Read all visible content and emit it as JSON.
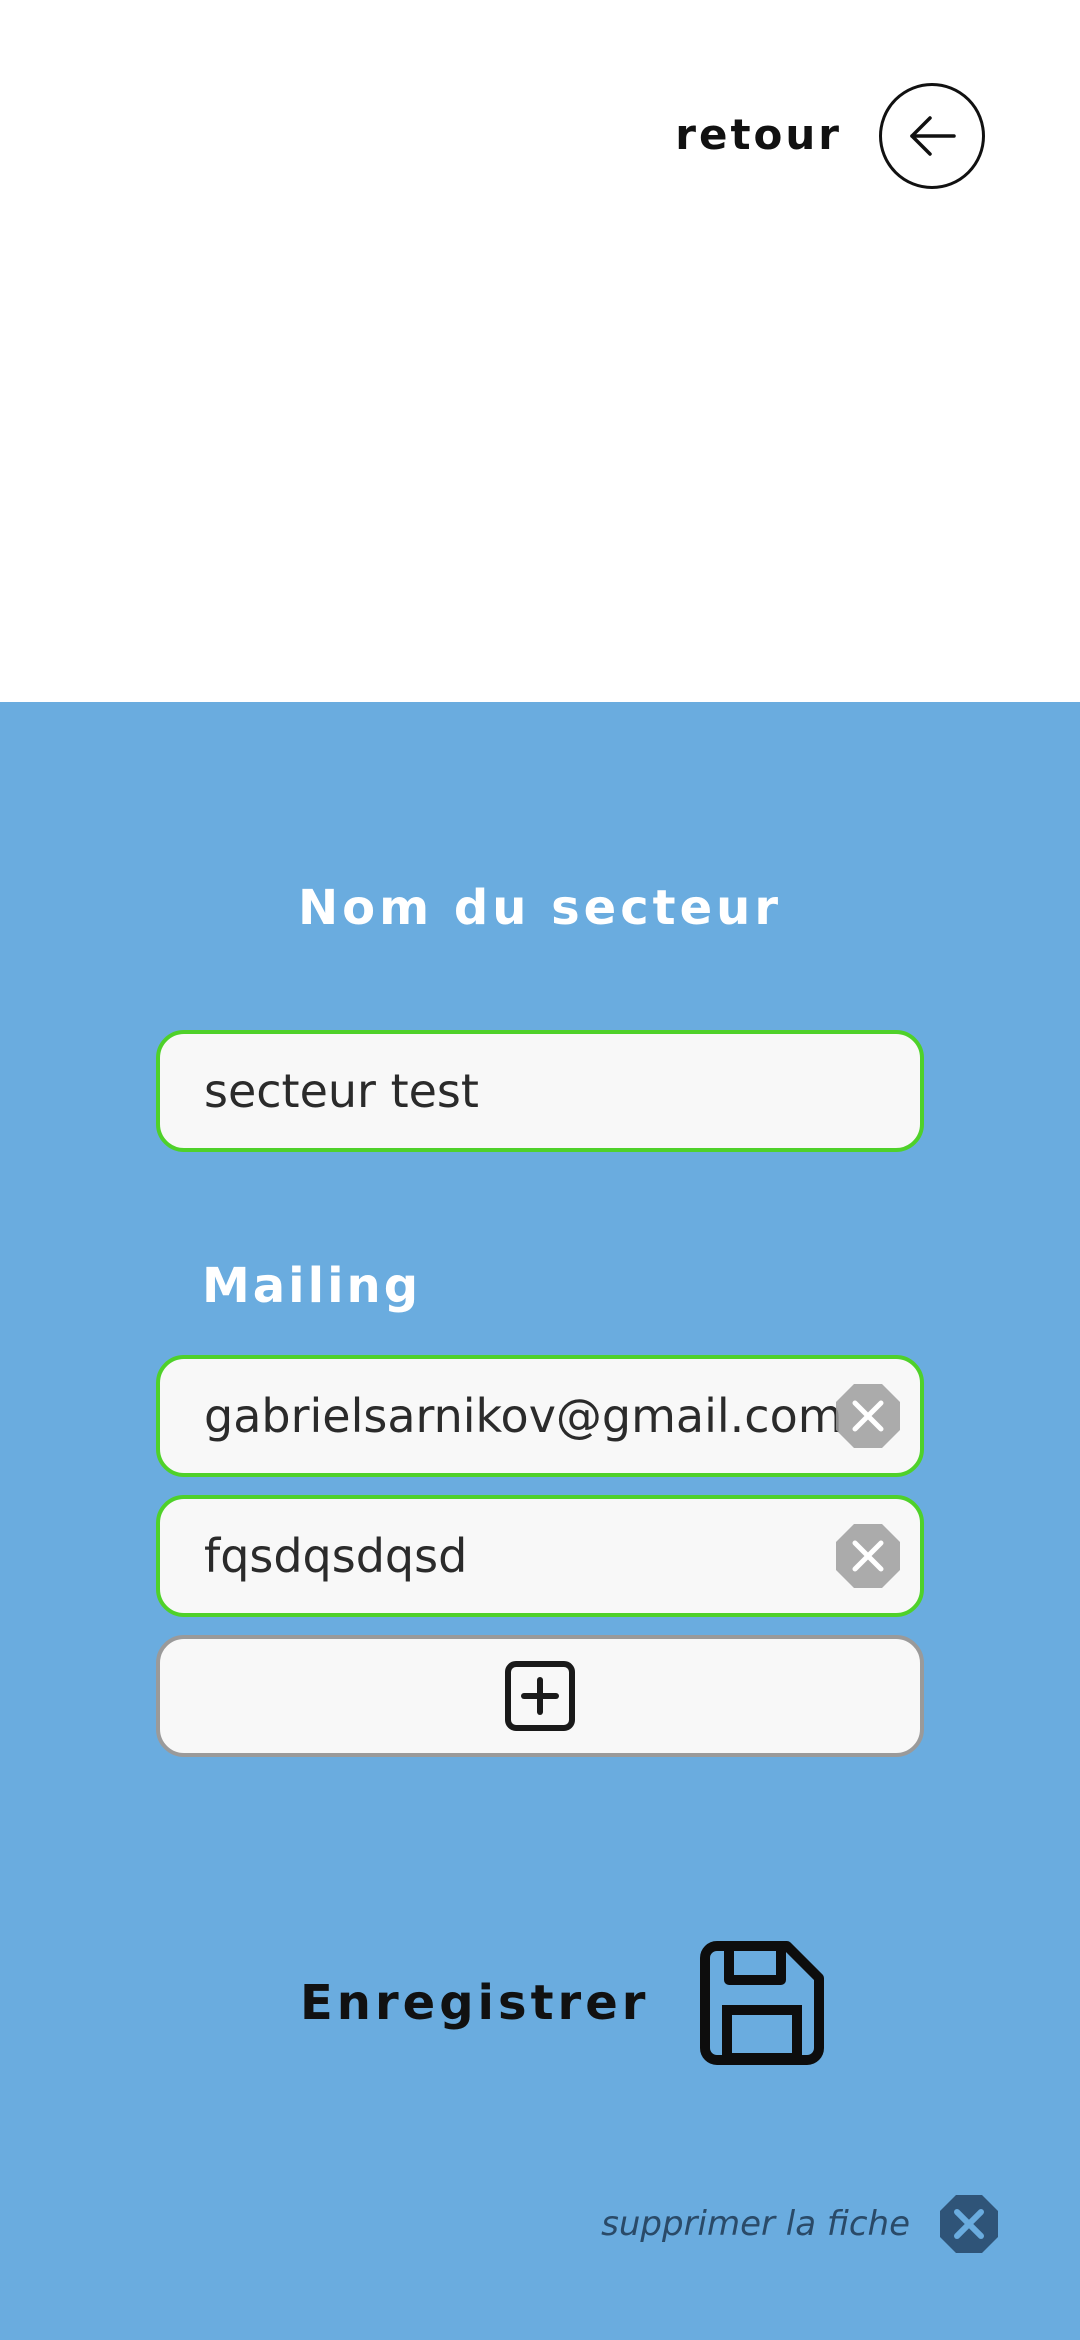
{
  "header": {
    "back_label": "retour"
  },
  "form": {
    "sector_title": "Nom du secteur",
    "sector_value": "secteur test",
    "mailing_label": "Mailing",
    "mailing_entries": [
      {
        "value": "gabrielsarnikov@gmail.com"
      },
      {
        "value": "fqsdqsdqsd"
      }
    ]
  },
  "actions": {
    "save_label": "Enregistrer",
    "delete_label": "supprimer la fiche"
  },
  "icons": {
    "back": "arrow-left-circle-icon",
    "remove": "close-octagon-icon",
    "add": "plus-square-icon",
    "save": "floppy-disk-icon",
    "delete": "close-octagon-icon"
  },
  "colors": {
    "accent_blue": "#6aacdf",
    "valid_border": "#4fd12a",
    "neutral_border": "#9a9a9a",
    "delete_icon": "#2f5478"
  }
}
